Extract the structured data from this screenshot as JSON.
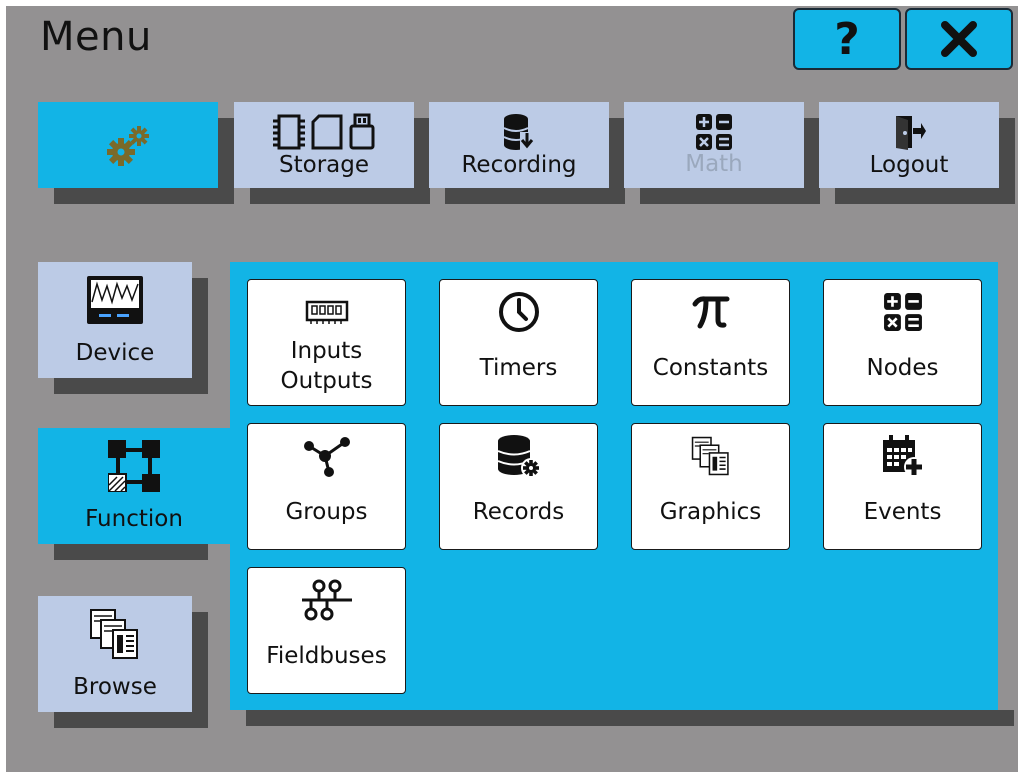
{
  "title": "Menu",
  "header_buttons": {
    "help_label": "?",
    "close_label": "✕"
  },
  "top_tabs": [
    {
      "label": "",
      "icon": "gears-icon",
      "active": true
    },
    {
      "label": "Storage",
      "icon": "storage-devices-icon"
    },
    {
      "label": "Recording",
      "icon": "database-download-icon"
    },
    {
      "label": "Math",
      "icon": "calculator-icon",
      "disabled": true
    },
    {
      "label": "Logout",
      "icon": "logout-door-icon"
    }
  ],
  "side_tabs": [
    {
      "label": "Device",
      "icon": "device-display-icon"
    },
    {
      "label": "Function",
      "icon": "function-blocks-icon",
      "active": true
    },
    {
      "label": "Browse",
      "icon": "browse-pages-icon"
    }
  ],
  "function_tiles": [
    {
      "label": "Inputs\nOutputs",
      "icon": "io-module-icon"
    },
    {
      "label": "Timers",
      "icon": "clock-icon"
    },
    {
      "label": "Constants",
      "icon": "pi-icon"
    },
    {
      "label": "Nodes",
      "icon": "calculator-icon"
    },
    {
      "label": "Groups",
      "icon": "network-graph-icon"
    },
    {
      "label": "Records",
      "icon": "database-gear-icon"
    },
    {
      "label": "Graphics",
      "icon": "graphics-pages-icon"
    },
    {
      "label": "Events",
      "icon": "calendar-add-icon"
    },
    {
      "label": "Fieldbuses",
      "icon": "fieldbus-icon"
    }
  ],
  "colors": {
    "background": "#939192",
    "accent": "#12b4e6",
    "tab": "#bccbe6",
    "shadow": "#4a4a4a"
  }
}
